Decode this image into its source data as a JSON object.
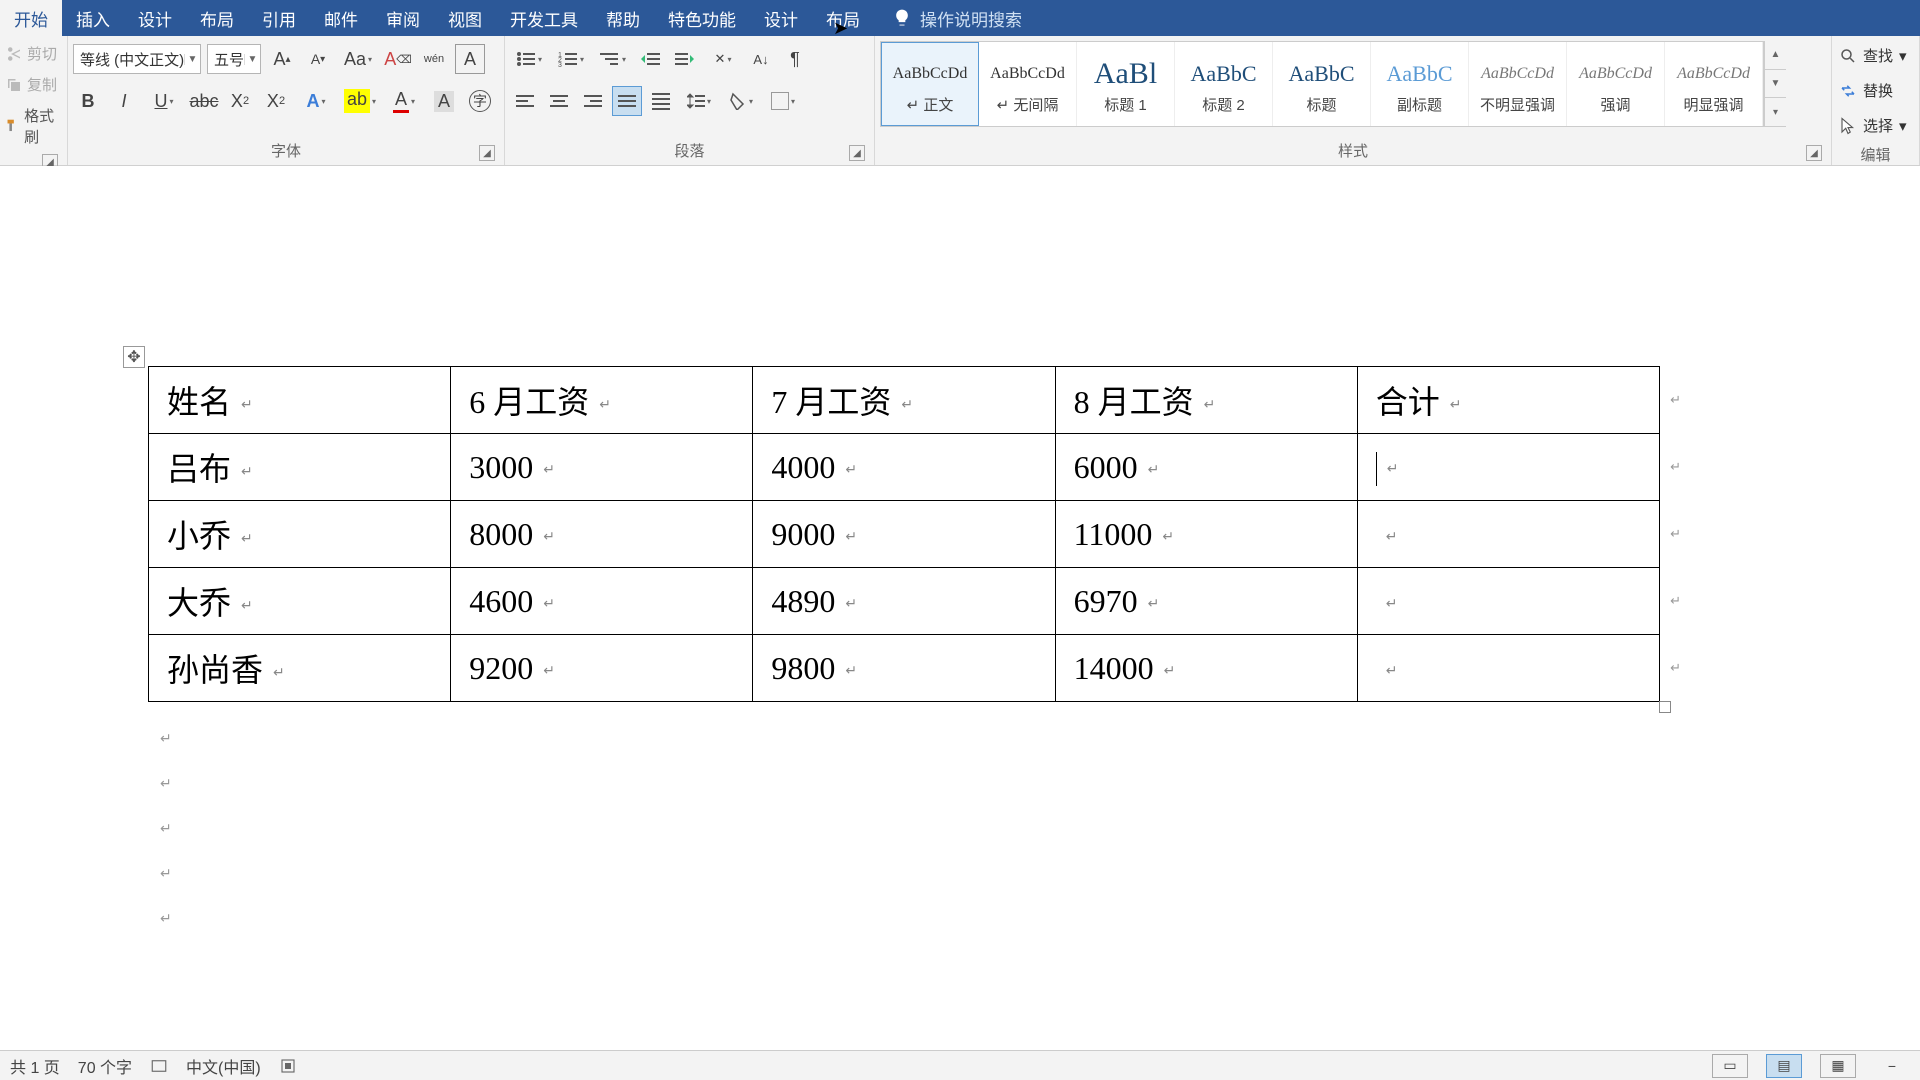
{
  "menu": {
    "tabs": [
      "开始",
      "插入",
      "设计",
      "布局",
      "引用",
      "邮件",
      "审阅",
      "视图",
      "开发工具",
      "帮助",
      "特色功能",
      "设计",
      "布局"
    ],
    "active_index": 0,
    "highlight_index": 12,
    "search_placeholder": "操作说明搜索"
  },
  "clipboard": {
    "cut": "剪切",
    "copy": "复制",
    "format_painter": "格式刷"
  },
  "font": {
    "font_name": "等线 (中文正文)",
    "font_size": "五号",
    "group_label": "字体"
  },
  "paragraph": {
    "group_label": "段落"
  },
  "styles": {
    "group_label": "样式",
    "items": [
      {
        "preview": "AaBbCcDd",
        "name": "正文",
        "cls": "s16",
        "selected": true,
        "corner": "↵"
      },
      {
        "preview": "AaBbCcDd",
        "name": "无间隔",
        "cls": "s16",
        "corner": "↵"
      },
      {
        "preview": "AaBl",
        "name": "标题 1",
        "cls": "s30"
      },
      {
        "preview": "AaBbC",
        "name": "标题 2",
        "cls": "s22"
      },
      {
        "preview": "AaBbC",
        "name": "标题",
        "cls": "s22"
      },
      {
        "preview": "AaBbC",
        "name": "副标题",
        "cls": "s22 sub"
      },
      {
        "preview": "AaBbCcDd",
        "name": "不明显强调",
        "cls": "s16 italic"
      },
      {
        "preview": "AaBbCcDd",
        "name": "强调",
        "cls": "s16 italic"
      },
      {
        "preview": "AaBbCcDd",
        "name": "明显强调",
        "cls": "s16 italic"
      }
    ]
  },
  "editing": {
    "find": "查找",
    "replace": "替换",
    "select": "选择",
    "group_label": "编辑"
  },
  "table": {
    "headers": [
      "姓名",
      "6 月工资",
      "7 月工资",
      "8 月工资",
      "合计"
    ],
    "rows": [
      {
        "cells": [
          "吕布",
          "3000",
          "4000",
          "6000",
          ""
        ],
        "cursor_col": 4
      },
      {
        "cells": [
          "小乔",
          "8000",
          "9000",
          "11000",
          ""
        ]
      },
      {
        "cells": [
          "大乔",
          "4600",
          "4890",
          "6970",
          ""
        ]
      },
      {
        "cells": [
          "孙尚香",
          "9200",
          "9800",
          "14000",
          ""
        ]
      }
    ]
  },
  "status": {
    "page": "共 1 页",
    "words": "70 个字",
    "lang": "中文(中国)"
  }
}
